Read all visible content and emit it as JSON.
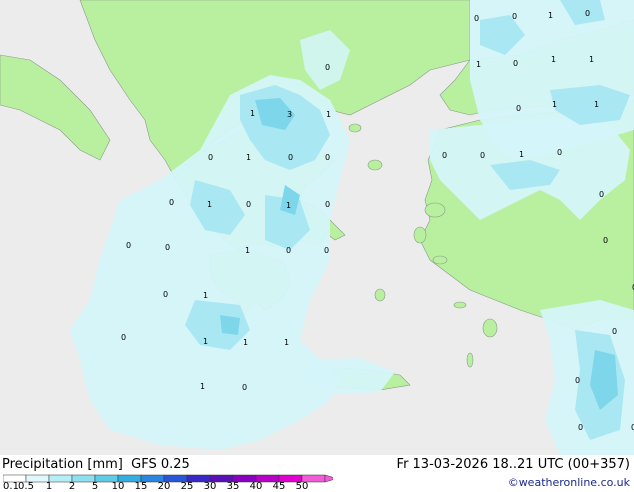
{
  "title": {
    "product": "Precipitation [mm]",
    "model": "GFS 0.25"
  },
  "datetime": "Fr 13-03-2026 18..21 UTC (00+357)",
  "credit": "©weatheronline.co.uk",
  "legend": {
    "ticks": [
      "0.1",
      "0.5",
      "1",
      "2",
      "5",
      "10",
      "15",
      "20",
      "25",
      "30",
      "35",
      "40",
      "45",
      "50"
    ],
    "colors": [
      "#ffffff",
      "#dff8fb",
      "#b6eef8",
      "#8ce0f0",
      "#5fcbe6",
      "#33aee0",
      "#2a86e0",
      "#2a55d8",
      "#3828c8",
      "#5a10b8",
      "#8a00c0",
      "#b800c8",
      "#e000d0",
      "#f25ad8"
    ]
  },
  "colors": {
    "land": "#b8f0a0",
    "sea_outside": "#ececec",
    "precip_light": "#d4f6fa",
    "precip_medium": "#a9e8f2",
    "precip_heavy": "#7dd6ea"
  },
  "map_values": [
    {
      "text": "0"
    },
    {
      "text": "0"
    },
    {
      "text": "1"
    },
    {
      "text": "0"
    },
    {
      "text": "1"
    },
    {
      "text": "1"
    },
    {
      "text": "0"
    },
    {
      "text": "1"
    },
    {
      "text": "1"
    },
    {
      "text": "0"
    },
    {
      "text": "1"
    },
    {
      "text": "1"
    },
    {
      "text": "3"
    },
    {
      "text": "1"
    },
    {
      "text": "0"
    },
    {
      "text": "1"
    },
    {
      "text": "0"
    },
    {
      "text": "0"
    },
    {
      "text": "0"
    },
    {
      "text": "0"
    },
    {
      "text": "1"
    },
    {
      "text": "0"
    },
    {
      "text": "1"
    },
    {
      "text": "0"
    },
    {
      "text": "0"
    },
    {
      "text": "0"
    },
    {
      "text": "1"
    },
    {
      "text": "0"
    },
    {
      "text": "0"
    },
    {
      "text": "0"
    },
    {
      "text": "0"
    },
    {
      "text": "0"
    },
    {
      "text": "1"
    },
    {
      "text": "0"
    },
    {
      "text": "0"
    },
    {
      "text": "0"
    },
    {
      "text": "1"
    },
    {
      "text": "0"
    },
    {
      "text": "1"
    },
    {
      "text": "1"
    },
    {
      "text": "1"
    },
    {
      "text": "0"
    },
    {
      "text": "1"
    },
    {
      "text": "0"
    },
    {
      "text": "0"
    },
    {
      "text": "0"
    },
    {
      "text": "0"
    },
    {
      "text": "0"
    }
  ]
}
